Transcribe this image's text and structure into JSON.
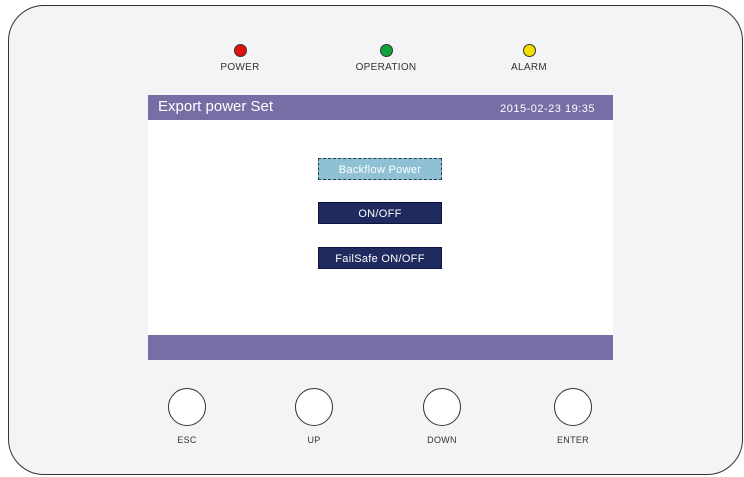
{
  "indicators": [
    {
      "label": "POWER",
      "color": "#e01010"
    },
    {
      "label": "OPERATION",
      "color": "#11a33a"
    },
    {
      "label": "ALARM",
      "color": "#f2e000"
    }
  ],
  "screen": {
    "title": "Export power Set",
    "datetime": "2015-02-23   19:35",
    "menu": [
      {
        "label": "Backflow Power",
        "selected": true
      },
      {
        "label": "ON/OFF",
        "selected": false
      },
      {
        "label": "FailSafe ON/OFF",
        "selected": false
      }
    ]
  },
  "keys": [
    {
      "label": "ESC"
    },
    {
      "label": "UP"
    },
    {
      "label": "DOWN"
    },
    {
      "label": "ENTER"
    }
  ],
  "colors": {
    "bar": "#776ea6",
    "menu_bg": "#1f2a5e",
    "menu_selected_bg": "#8fc0d4"
  }
}
